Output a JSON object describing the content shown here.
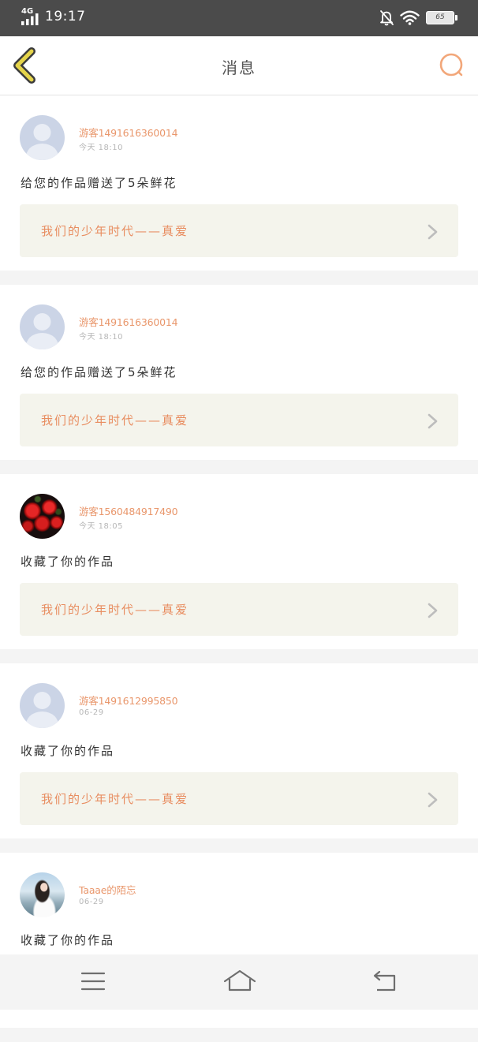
{
  "status_bar": {
    "network": "4G",
    "time": "19:17",
    "battery": "65",
    "icons": [
      "signal-icon",
      "bell-off-icon",
      "wifi-icon",
      "battery-icon"
    ]
  },
  "header": {
    "title": "消息",
    "back_icon": "back-chevron-icon",
    "search_icon": "search-icon"
  },
  "messages": [
    {
      "avatar": "default-avatar",
      "username": "游客1491616360014",
      "time": "今天 18:10",
      "text": "给您的作品赠送了5朵鲜花",
      "work_title": "我们的少年时代——真爱"
    },
    {
      "avatar": "default-avatar",
      "username": "游客1491616360014",
      "time": "今天 18:10",
      "text": "给您的作品赠送了5朵鲜花",
      "work_title": "我们的少年时代——真爱"
    },
    {
      "avatar": "roses-photo",
      "username": "游客1560484917490",
      "time": "今天 18:05",
      "text": "收藏了你的作品",
      "work_title": "我们的少年时代——真爱"
    },
    {
      "avatar": "default-avatar",
      "username": "游客1491612995850",
      "time": "06-29",
      "text": "收藏了你的作品",
      "work_title": "我们的少年时代——真爱"
    },
    {
      "avatar": "woman-photo",
      "username": "Taaae的陌忘",
      "time": "06-29",
      "text": "收藏了你的作品"
    }
  ],
  "nav": {
    "icons": [
      "menu-icon",
      "home-icon",
      "return-icon"
    ]
  },
  "colors": {
    "status_bar": "#4b4b4b",
    "accent_username": "#e9976c",
    "work_title": "#e88d60",
    "work_box": "#f4f4ec",
    "back_chevron": "#e5d44a",
    "search": "#f2a77a",
    "separator": "#f4f4f4"
  }
}
